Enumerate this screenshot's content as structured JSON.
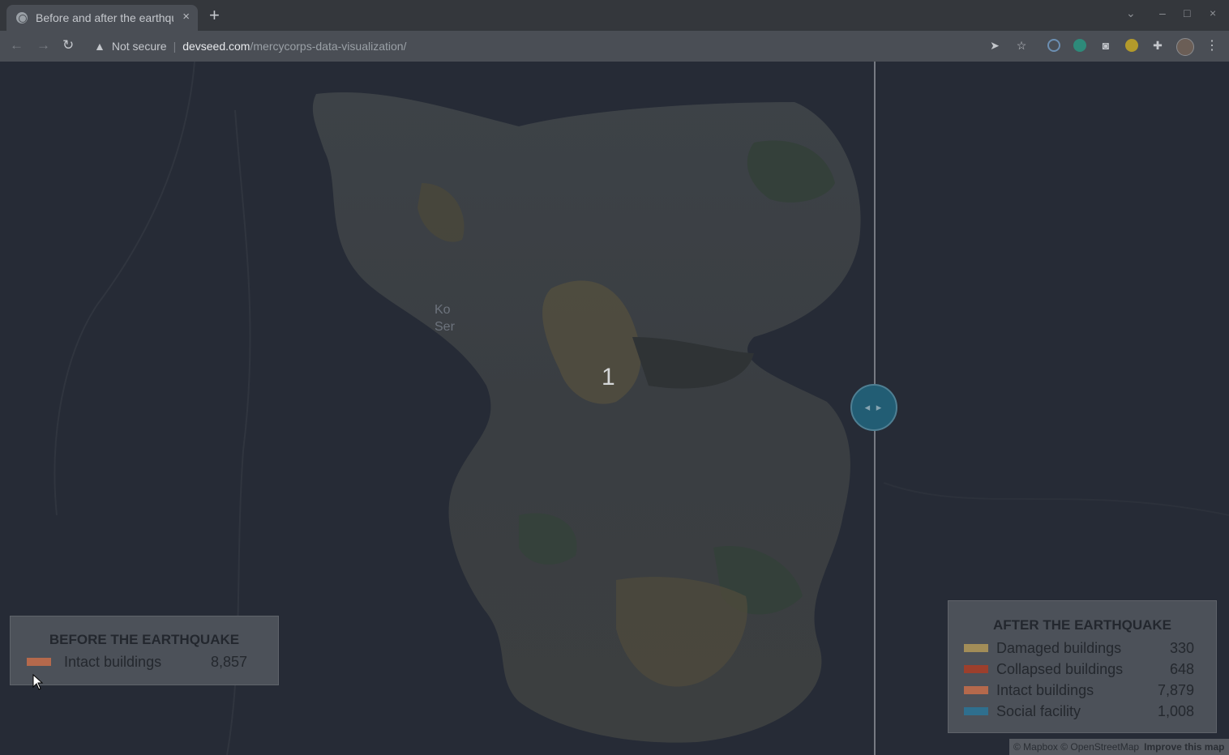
{
  "browser": {
    "tab_title": "Before and after the earthquake",
    "tab_close": "×",
    "new_tab": "+",
    "security_label": "Not secure",
    "url_host": "devseed.com",
    "url_path": "/mercycorps-data-visualization/"
  },
  "map": {
    "place_label_line1": "Ko",
    "place_label_line2": "Ser",
    "cluster_count": "1",
    "slider_arrows": "◂ ▸"
  },
  "legend_before": {
    "title": "BEFORE THE EARTHQUAKE",
    "items": [
      {
        "label": "Intact buildings",
        "value": "8,857",
        "color": "#b5694c"
      }
    ]
  },
  "legend_after": {
    "title": "AFTER THE EARTHQUAKE",
    "items": [
      {
        "label": "Damaged buildings",
        "value": "330",
        "color": "#a28d58"
      },
      {
        "label": "Collapsed buildings",
        "value": "648",
        "color": "#9c3f2c"
      },
      {
        "label": "Intact buildings",
        "value": "7,879",
        "color": "#b5694c"
      },
      {
        "label": "Social facility",
        "value": "1,008",
        "color": "#2f6f8e"
      }
    ]
  },
  "attribution": {
    "mapbox": "© Mapbox",
    "osm": "© OpenStreetMap",
    "improve": "Improve this map"
  },
  "colors": {
    "map_background": "#262b36",
    "imagery": "#3b3f43",
    "slider": "#225d74"
  }
}
